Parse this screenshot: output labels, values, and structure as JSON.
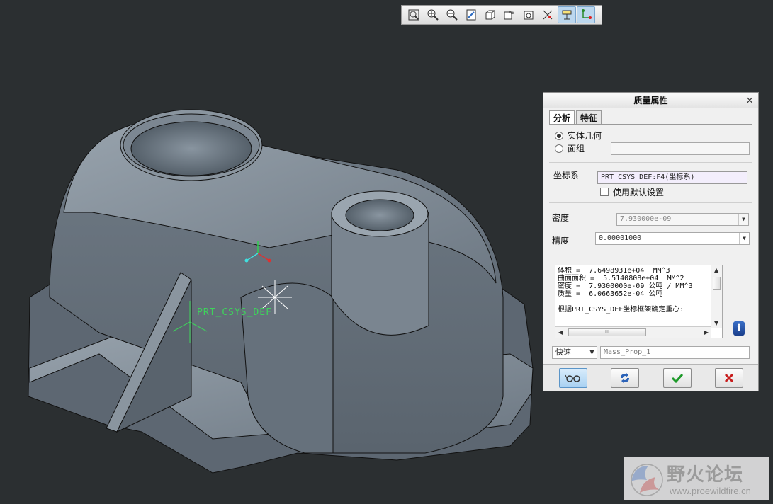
{
  "toolbar": {
    "buttons": [
      {
        "name": "refit-icon"
      },
      {
        "name": "zoom-in-icon"
      },
      {
        "name": "zoom-out-icon"
      },
      {
        "name": "repaint-icon"
      },
      {
        "name": "display-style-icon"
      },
      {
        "name": "saved-views-icon"
      },
      {
        "name": "layers-icon"
      },
      {
        "name": "datum-display-icon"
      },
      {
        "name": "annotation-display-icon",
        "active": true
      },
      {
        "name": "csys-display-icon",
        "active": true
      }
    ]
  },
  "viewport": {
    "csys_label": "PRT_CSYS_DEF",
    "background": "#2b2f31",
    "model_color": "#7e8994"
  },
  "dialog": {
    "title": "质量属性",
    "close": "×",
    "tabs": [
      {
        "label": "分析",
        "active": true
      },
      {
        "label": "特征",
        "active": false
      }
    ],
    "radio_solid": "实体几何",
    "radio_quilt": "面组",
    "csys_label": "坐标系",
    "csys_value": "PRT_CSYS_DEF:F4(坐标系)",
    "use_default": "使用默认设置",
    "density_label": "密度",
    "density_value": "7.930000e-09",
    "accuracy_label": "精度",
    "accuracy_value": "0.00001000",
    "results_text": "体积 =  7.6498931e+04  MM^3\n曲面面积 =  5.5140808e+04  MM^2\n密度 =  7.9300000e-09 公吨 / MM^3\n质量 =  6.0663652e-04 公吨\n\n根据PRT_CSYS_DEF坐标框架确定重心:",
    "hscroll_grip": "III",
    "info": "i",
    "mode_value": "快速",
    "name_value": "Mass_Prop_1"
  },
  "watermark": {
    "title": "野火论坛",
    "url": "www.proewildfire.cn"
  }
}
